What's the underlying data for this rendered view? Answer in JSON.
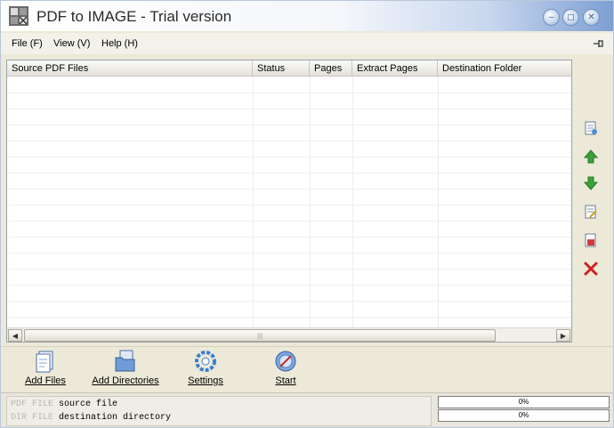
{
  "window": {
    "title": "PDF to IMAGE - Trial version"
  },
  "menu": {
    "file": "File (F)",
    "view": "View (V)",
    "help": "Help (H)"
  },
  "table": {
    "columns": [
      "Source PDF Files",
      "Status",
      "Pages",
      "Extract Pages",
      "Destination Folder"
    ],
    "rows": []
  },
  "side_tools": [
    {
      "icon": "page-settings-icon"
    },
    {
      "icon": "move-up-icon"
    },
    {
      "icon": "move-down-icon"
    },
    {
      "icon": "edit-icon"
    },
    {
      "icon": "delete-page-icon"
    },
    {
      "icon": "remove-icon"
    }
  ],
  "toolbar": {
    "add_files": "Add Files",
    "add_directories": "Add Directories",
    "settings": "Settings",
    "start": "Start"
  },
  "status": {
    "line1_tag": "PDF FILE",
    "line1_text": "source file",
    "line2_tag": "DIR FILE",
    "line2_text": "destination directory",
    "progress1": "0%",
    "progress2": "0%"
  },
  "colors": {
    "accent_blue": "#3b6fc0",
    "arrow_green": "#3aa13a",
    "remove_red": "#d02020"
  }
}
